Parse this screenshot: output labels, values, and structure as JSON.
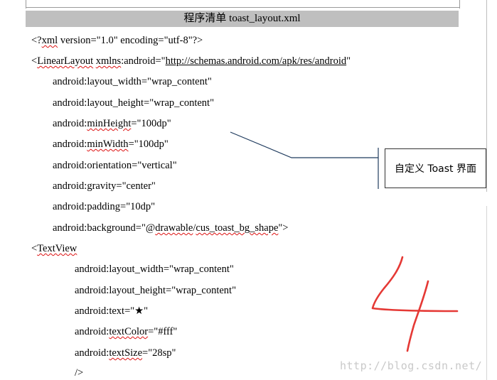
{
  "header": {
    "title": "程序清单 toast_layout.xml"
  },
  "code": {
    "l1_pre": "<?",
    "l1_sq": "xml",
    "l1_post": " version=\"1.0\" encoding=\"utf-8\"?>",
    "l2_a": "<",
    "l2_sq1": "LinearLayout",
    "l2_sp": " ",
    "l2_sq2": "xmlns",
    "l2_b": ":android=\"",
    "l2_url": "http://schemas.android.com/apk/res/android",
    "l2_c": "\"",
    "l3": "android:layout_width=\"wrap_content\"",
    "l4": "android:layout_height=\"wrap_content\"",
    "l5_pre": "android:",
    "l5_sq": "minHeight",
    "l5_post": "=\"100dp\"",
    "l6_pre": "android:",
    "l6_sq": "minWidth",
    "l6_post": "=\"100dp\"",
    "l7": "android:orientation=\"vertical\"",
    "l8": "android:gravity=\"center\"",
    "l9": "android:padding=\"10dp\"",
    "l10_pre": "android:background=\"@",
    "l10_sq1": "drawable",
    "l10_sl": "/",
    "l10_sq2": "cus_toast_bg_shape",
    "l10_post": "\">",
    "l11_a": "<",
    "l11_sq": "TextView",
    "l12": "android:layout_width=\"wrap_content\"",
    "l13": "android:layout_height=\"wrap_content\"",
    "l14": "android:text=\"★\"",
    "l15_pre": "android:",
    "l15_sq": "textColor",
    "l15_post": "=\"#fff\"",
    "l16_pre": "android:",
    "l16_sq": "textSize",
    "l16_post": "=\"28sp\"",
    "l17": "/>"
  },
  "callout": {
    "label": "自定义 Toast 界面"
  },
  "watermark": {
    "text": "http://blog.csdn.net/"
  },
  "colors": {
    "header_bg": "#bfbfbf",
    "handwriting": "#e53935",
    "squiggle": "#dd1111"
  }
}
